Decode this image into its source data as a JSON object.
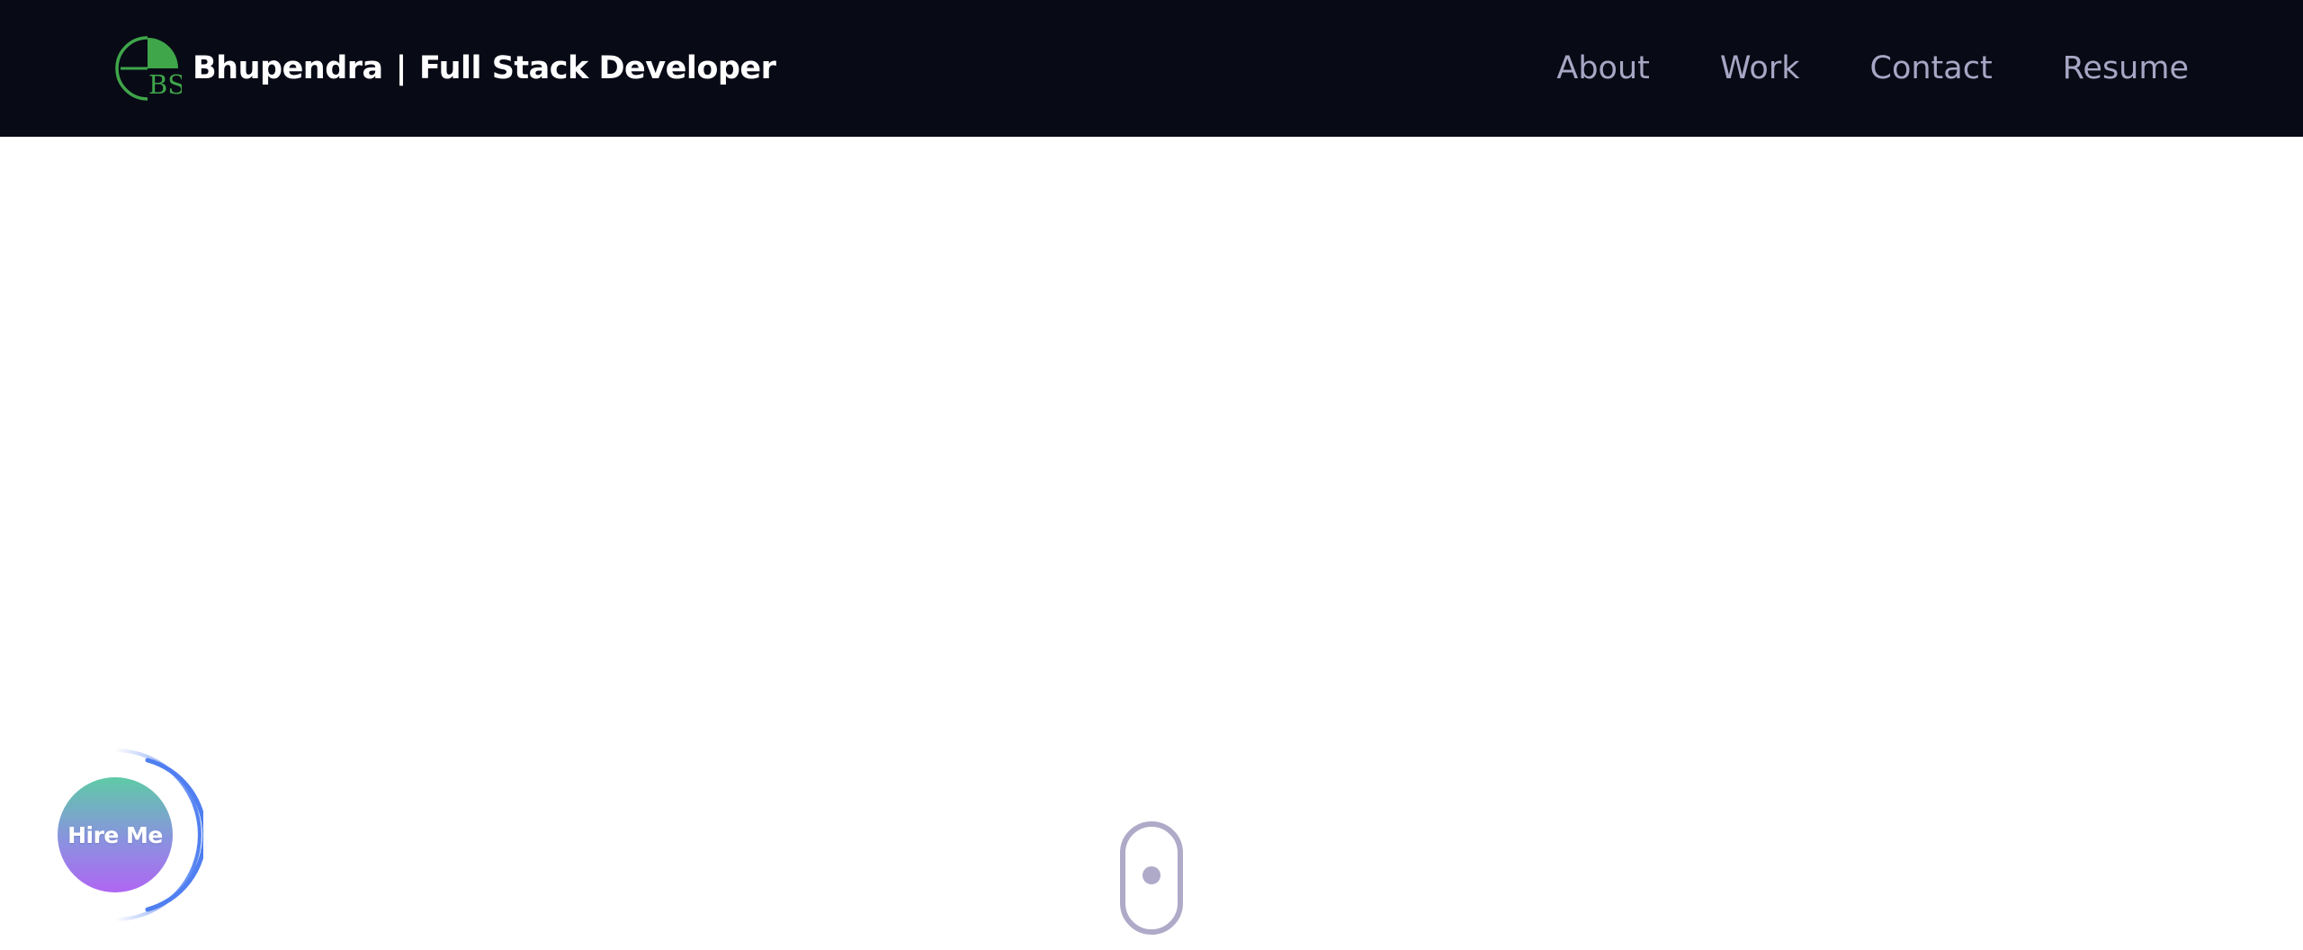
{
  "header": {
    "logo": {
      "icon": "bs-monogram-logo",
      "text": "BS"
    },
    "brand_name": "Bhupendra",
    "brand_separator": "|",
    "brand_role": "Full Stack Developer"
  },
  "nav": {
    "links": [
      {
        "label": "About"
      },
      {
        "label": "Work"
      },
      {
        "label": "Contact"
      },
      {
        "label": "Resume"
      }
    ]
  },
  "hire_me": {
    "label": "Hire Me"
  },
  "scroll_indicator": {
    "icon": "mouse-scroll-icon"
  },
  "colors": {
    "navbar_bg": "#080a16",
    "brand_text": "#ffffff",
    "nav_link": "#a8a6c4",
    "logo_green": "#3fa64a",
    "hire_gradient_top": "#5ecaa6",
    "hire_gradient_bottom": "#b066f2",
    "hire_ring": "#4f7ff0",
    "scroll_icon": "#aeaac8"
  }
}
